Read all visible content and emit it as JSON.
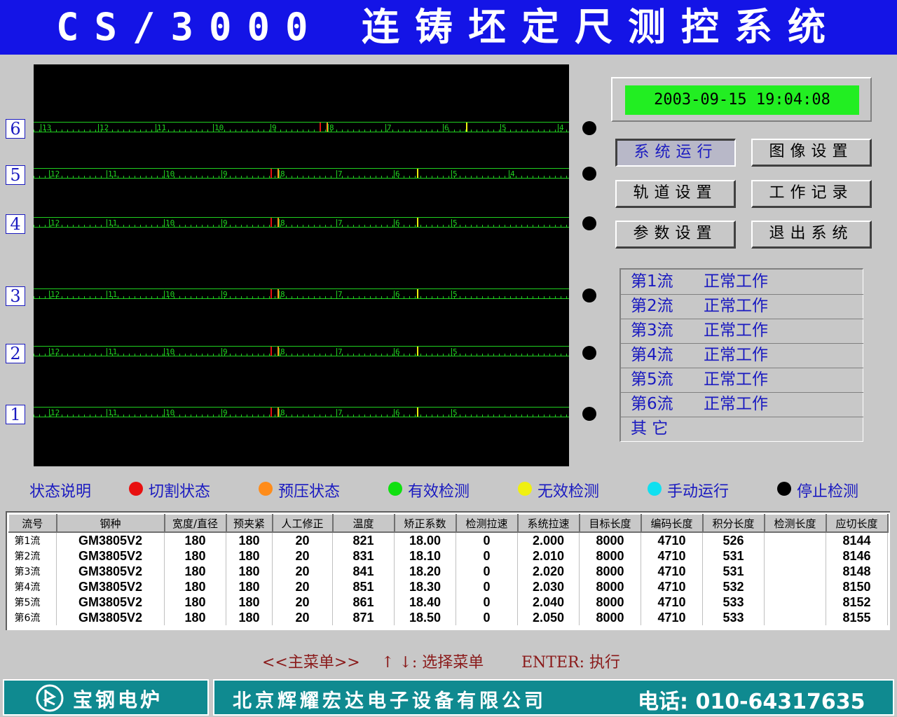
{
  "title": "CS/3000 连铸坯定尺测控系统",
  "clock": "2003-09-15 19:04:08",
  "buttons": {
    "run": "系统运行",
    "image_settings": "图像设置",
    "track_settings": "轨道设置",
    "work_log": "工作记录",
    "param_settings": "参数设置",
    "exit": "退出系统"
  },
  "streams": [
    {
      "num": "6",
      "labels": [
        "13",
        "12",
        "11",
        "10",
        "9",
        "8",
        "7",
        "6",
        "5",
        "4"
      ],
      "red": 8.15,
      "yellow": 5.6
    },
    {
      "num": "5",
      "labels": [
        "12",
        "11",
        "10",
        "9",
        "8",
        "7",
        "6",
        "5",
        "4"
      ],
      "red": 8.15,
      "yellow": 5.6
    },
    {
      "num": "4",
      "labels": [
        "12",
        "11",
        "10",
        "9",
        "8",
        "7",
        "6",
        "5"
      ],
      "red": 8.15,
      "yellow": 5.6
    },
    {
      "num": "3",
      "labels": [
        "12",
        "11",
        "10",
        "9",
        "8",
        "7",
        "6",
        "5"
      ],
      "red": 8.15,
      "yellow": 5.6
    },
    {
      "num": "2",
      "labels": [
        "12",
        "11",
        "10",
        "9",
        "8",
        "7",
        "6",
        "5"
      ],
      "red": 8.15,
      "yellow": 5.6
    },
    {
      "num": "1",
      "labels": [
        "12",
        "11",
        "10",
        "9",
        "8",
        "7",
        "6",
        "5"
      ],
      "red": 8.15,
      "yellow": 5.6
    }
  ],
  "status_list": [
    {
      "name": "第1流",
      "state": "正常工作"
    },
    {
      "name": "第2流",
      "state": "正常工作"
    },
    {
      "name": "第3流",
      "state": "正常工作"
    },
    {
      "name": "第4流",
      "state": "正常工作"
    },
    {
      "name": "第5流",
      "state": "正常工作"
    },
    {
      "name": "第6流",
      "state": "正常工作"
    },
    {
      "name": "其 它",
      "state": ""
    }
  ],
  "legend": {
    "title": "状态说明",
    "items": [
      {
        "label": "切割状态",
        "color": "#e81010"
      },
      {
        "label": "预压状态",
        "color": "#ff8c1a"
      },
      {
        "label": "有效检测",
        "color": "#10e010"
      },
      {
        "label": "无效检测",
        "color": "#f0f010"
      },
      {
        "label": "手动运行",
        "color": "#10e0f0"
      },
      {
        "label": "停止检测",
        "color": "#000000"
      }
    ]
  },
  "table": {
    "headers": [
      "流号",
      "钢种",
      "宽度/直径",
      "预夹紧",
      "人工修正",
      "温度",
      "矫正系数",
      "检测拉速",
      "系统拉速",
      "目标长度",
      "编码长度",
      "积分长度",
      "检测长度",
      "应切长度"
    ],
    "rows": [
      [
        "第1流",
        "GM3805V2",
        "180",
        "180",
        "20",
        "821",
        "18.00",
        "0",
        "2.000",
        "8000",
        "4710",
        "526",
        "",
        "8144"
      ],
      [
        "第2流",
        "GM3805V2",
        "180",
        "180",
        "20",
        "831",
        "18.10",
        "0",
        "2.010",
        "8000",
        "4710",
        "531",
        "",
        "8146"
      ],
      [
        "第3流",
        "GM3805V2",
        "180",
        "180",
        "20",
        "841",
        "18.20",
        "0",
        "2.020",
        "8000",
        "4710",
        "531",
        "",
        "8148"
      ],
      [
        "第4流",
        "GM3805V2",
        "180",
        "180",
        "20",
        "851",
        "18.30",
        "0",
        "2.030",
        "8000",
        "4710",
        "532",
        "",
        "8150"
      ],
      [
        "第5流",
        "GM3805V2",
        "180",
        "180",
        "20",
        "861",
        "18.40",
        "0",
        "2.040",
        "8000",
        "4710",
        "533",
        "",
        "8152"
      ],
      [
        "第6流",
        "GM3805V2",
        "180",
        "180",
        "20",
        "871",
        "18.50",
        "0",
        "2.050",
        "8000",
        "4710",
        "533",
        "",
        "8155"
      ]
    ]
  },
  "hint": {
    "menu": "<<主菜单>>",
    "arrows": "↑ ↓: 选择菜单",
    "enter": "ENTER: 执行"
  },
  "footer": {
    "logo_text": "宝钢电炉",
    "company": "北京辉耀宏达电子设备有限公司",
    "phone": "电话: 010-64317635"
  },
  "colors": {
    "title_bg": "#1414e6",
    "track_green": "#20d020",
    "footer_bg": "#0f8a90"
  }
}
